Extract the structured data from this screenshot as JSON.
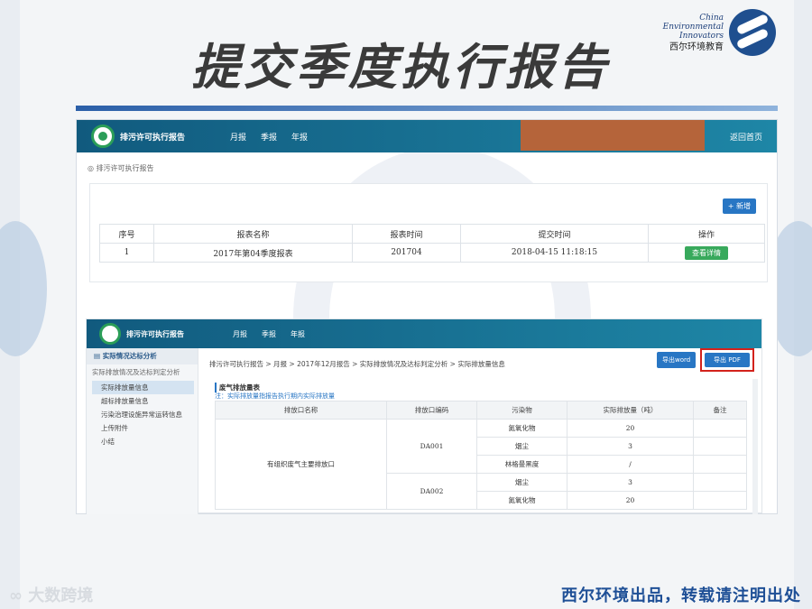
{
  "slide": {
    "title": "提交季度执行报告",
    "brand_line1": "China",
    "brand_line2": "Environmental",
    "brand_line3": "Innovators",
    "brand_cn": "西尔环境教育",
    "footer_left": "大数跨境",
    "footer_right": "西尔环境出品，转载请注明出处"
  },
  "app": {
    "name": "排污许可执行报告",
    "menu": [
      "月报",
      "季报",
      "年报"
    ],
    "home": "返回首页",
    "breadcrumb": "排污许可执行报告",
    "new_button": "+ 新增",
    "columns": [
      "序号",
      "报表名称",
      "报表时间",
      "提交时间",
      "操作"
    ],
    "rows": [
      {
        "no": "1",
        "name": "2017年第04季度报表",
        "period": "201704",
        "submitted": "2018-04-15 11:18:15",
        "action": "查看详情"
      }
    ]
  },
  "detail": {
    "name": "排污许可执行报告",
    "menu": [
      "月报",
      "季报",
      "年报"
    ],
    "sidebar_head": "实际情况达标分析",
    "sidebar_sub": "实际排放情况及达标判定分析",
    "sidebar_items": [
      "实际排放量信息",
      "超标排放量信息",
      "污染治理设施异常运转信息",
      "上传附件",
      "小结"
    ],
    "breadcrumb": "排污许可执行报告 > 月报 > 2017年12月报告 > 实际排放情况及达标判定分析 > 实际排放量信息",
    "export_word": "导出word",
    "export_pdf": "导出 PDF",
    "section_title": "废气排放量表",
    "note": "注：实际排放量指报告执行期内实际排放量",
    "columns": [
      "排放口名称",
      "排放口编码",
      "污染物",
      "实际排放量（吨）",
      "备注"
    ],
    "outlet_name": "有组织废气主要排放口",
    "outlets": [
      {
        "code": "DA001",
        "rows": [
          {
            "pollutant": "氮氧化物",
            "amount": "20"
          },
          {
            "pollutant": "烟尘",
            "amount": "3"
          },
          {
            "pollutant": "林格曼黑度",
            "amount": "/"
          }
        ]
      },
      {
        "code": "DA002",
        "rows": [
          {
            "pollutant": "烟尘",
            "amount": "3"
          },
          {
            "pollutant": "氮氧化物",
            "amount": "20"
          }
        ]
      }
    ]
  },
  "colors": {
    "nav": "#1a7199",
    "primary_button": "#2876c4",
    "view_button": "#38a95c",
    "highlight_box": "#d3221c",
    "footer_text": "#1e4f96"
  }
}
